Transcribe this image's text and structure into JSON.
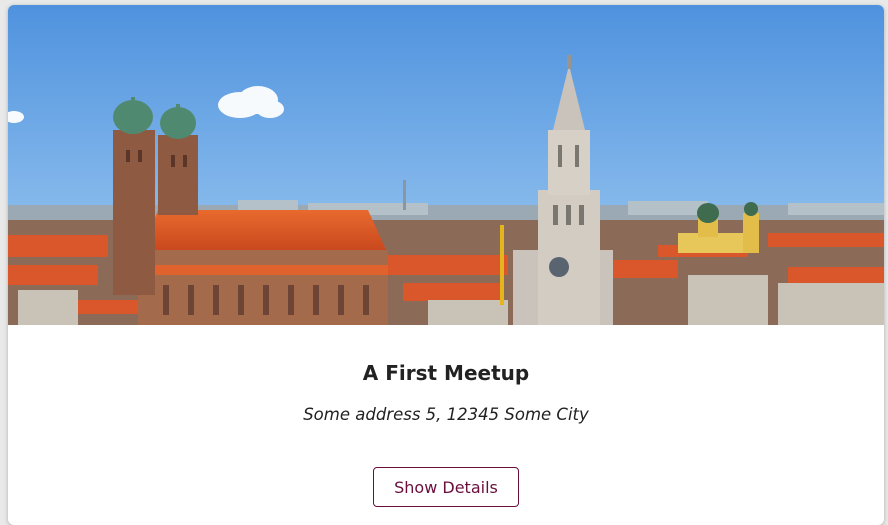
{
  "meetup": {
    "title": "A First Meetup",
    "address": "Some address 5, 12345 Some City",
    "details_button_label": "Show Details",
    "image_subject": "munich-skyline-photo"
  },
  "colors": {
    "accent": "#6a0f3c",
    "sky": "#5c9fe0",
    "roofs": "#d9572a"
  }
}
